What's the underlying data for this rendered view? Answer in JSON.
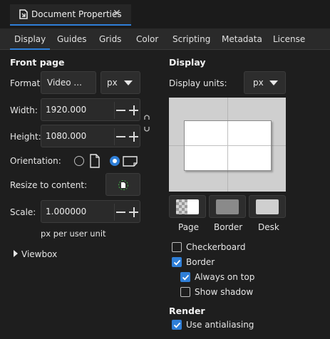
{
  "window": {
    "title": "Document Properties",
    "close_glyph": "✕"
  },
  "tabs": [
    {
      "label": "Display"
    },
    {
      "label": "Guides"
    },
    {
      "label": "Grids"
    },
    {
      "label": "Color"
    },
    {
      "label": "Scripting"
    },
    {
      "label": "Metadata"
    },
    {
      "label": "License"
    }
  ],
  "front_page": {
    "heading": "Front page",
    "format_label": "Format:",
    "format_value": "Video ...",
    "format_unit": "px",
    "width_label": "Width:",
    "width_value": "1920.000",
    "height_label": "Height:",
    "height_value": "1080.000",
    "orientation_label": "Orientation:",
    "orientation_selected": "landscape",
    "resize_label": "Resize to content:",
    "scale_label": "Scale:",
    "scale_value": "1.000000",
    "scale_units": "px per user unit",
    "viewbox_label": "Viewbox"
  },
  "display": {
    "heading": "Display",
    "units_label": "Display units:",
    "units_value": "px",
    "swatches": [
      {
        "label": "Page"
      },
      {
        "label": "Border"
      },
      {
        "label": "Desk"
      }
    ],
    "checkboxes": {
      "checkerboard": {
        "label": "Checkerboard",
        "checked": false
      },
      "border": {
        "label": "Border",
        "checked": true
      },
      "always_on_top": {
        "label": "Always on top",
        "checked": true
      },
      "show_shadow": {
        "label": "Show shadow",
        "checked": false
      }
    }
  },
  "render": {
    "heading": "Render",
    "antialiasing": {
      "label": "Use antialiasing",
      "checked": true
    }
  },
  "colors": {
    "accent": "#2f7fd8",
    "background": "#1e1e1e",
    "preview_desk": "#cfcfcf",
    "preview_page": "#ffffff"
  }
}
